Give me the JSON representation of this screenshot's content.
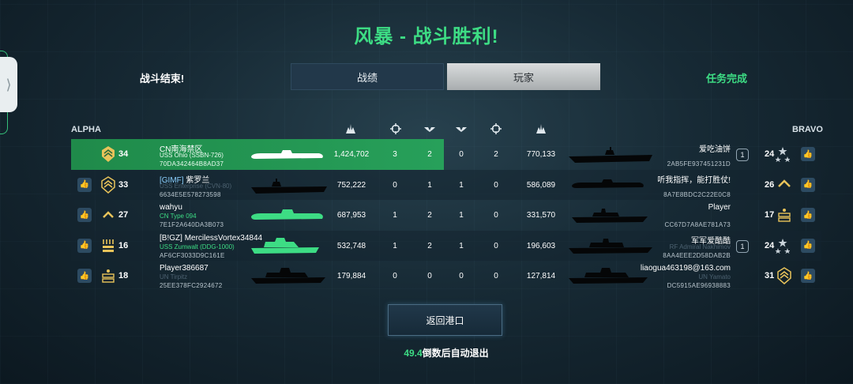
{
  "title": "风暴 - 战斗胜利!",
  "tabs": {
    "left_label": "战斗结束!",
    "stats_label": "战绩",
    "players_label": "玩家",
    "right_label": "任务完成"
  },
  "teams": {
    "alpha": "ALPHA",
    "bravo": "BRAVO"
  },
  "colors": {
    "accent": "#3ddc84",
    "highlight_row": "#27a05a",
    "tab_active": "#bfc3c5"
  },
  "column_icons": [
    "damage-icon",
    "crosshair-icon",
    "wings-icon",
    "wings-icon",
    "crosshair-icon",
    "damage-icon"
  ],
  "rows": [
    {
      "left": {
        "level": "34",
        "rank_icon": "rank-chevron-star-gold",
        "name": "CN南海禁区",
        "clan": "",
        "ship": "USS Ohio (SSBN-726)",
        "uid": "70DA342464B8AD37",
        "ship_silhouette": "submarine-white"
      },
      "stats": {
        "damage_left": "1,424,702",
        "kills_left": "3",
        "assists_left": "2",
        "assists_right": "0",
        "kills_right": "2",
        "damage_right": "770,133"
      },
      "right": {
        "name": "爱吃油饼",
        "ship": "",
        "uid": "2AB5FE937451231D",
        "level": "24",
        "rank_icon": "rank-three-stars-silver",
        "badge": "1",
        "ship_silhouette": "carrier-black"
      }
    },
    {
      "left": {
        "level": "33",
        "rank_icon": "rank-chevron-star-gold",
        "name": "紫罗兰",
        "clan": "[GIMF]",
        "ship": "USS Enterprise (CVN-80)",
        "uid": "6634E5E578273598",
        "ship_silhouette": "carrier-black"
      },
      "stats": {
        "damage_left": "752,222",
        "kills_left": "0",
        "assists_left": "1",
        "assists_right": "1",
        "kills_right": "0",
        "damage_right": "586,089"
      },
      "right": {
        "name": "听我指挥，能打胜仗!",
        "ship": "",
        "uid": "8A7E8BDC2C22E0C8",
        "level": "26",
        "rank_icon": "rank-chevron-gold",
        "badge": "",
        "ship_silhouette": "submarine-black"
      }
    },
    {
      "left": {
        "level": "27",
        "rank_icon": "rank-chevron-gold",
        "name": "wahyu",
        "clan": "",
        "ship": "CN Type 094",
        "uid": "7E1F2A640DA3B073",
        "ship_silhouette": "submarine-green"
      },
      "stats": {
        "damage_left": "687,953",
        "kills_left": "1",
        "assists_left": "2",
        "assists_right": "1",
        "kills_right": "0",
        "damage_right": "331,570"
      },
      "right": {
        "name": "Player",
        "ship": "",
        "uid": "CC67D7A8AE781A73",
        "level": "17",
        "rank_icon": "rank-bars-gold",
        "badge": "",
        "ship_silhouette": "destroyer-black"
      }
    },
    {
      "left": {
        "level": "16",
        "rank_icon": "rank-bars-gold",
        "name": "MercilessVortex34844",
        "clan": "[B!GZ]",
        "ship": "USS Zumwalt (DDG-1000)",
        "uid": "AF6CF3033D9C161E",
        "ship_silhouette": "destroyer-green"
      },
      "stats": {
        "damage_left": "532,748",
        "kills_left": "1",
        "assists_left": "2",
        "assists_right": "1",
        "kills_right": "0",
        "damage_right": "196,603"
      },
      "right": {
        "name": "军军爱酷酷",
        "ship": "RF Admiral Nakhimov",
        "uid": "8AA4EEE2D58DAB2B",
        "level": "24",
        "rank_icon": "rank-three-stars-silver",
        "badge": "1",
        "ship_silhouette": "cruiser-black"
      }
    },
    {
      "left": {
        "level": "18",
        "rank_icon": "rank-bars-gold",
        "name": "Player386687",
        "clan": "",
        "ship": "UN Tirpitz",
        "uid": "25EE378FC2924672",
        "ship_silhouette": "battleship-black"
      },
      "stats": {
        "damage_left": "179,884",
        "kills_left": "0",
        "assists_left": "0",
        "assists_right": "0",
        "kills_right": "0",
        "damage_right": "127,814"
      },
      "right": {
        "name": "liaogua463198@163.com",
        "ship": "UN Yamato",
        "uid": "DC5915AE96938883",
        "level": "31",
        "rank_icon": "rank-chevron-star-gold",
        "badge": "",
        "ship_silhouette": "battleship-black"
      }
    }
  ],
  "return_button": "返回港口",
  "countdown": {
    "seconds": "49.4",
    "text": "倒数后自动退出"
  }
}
